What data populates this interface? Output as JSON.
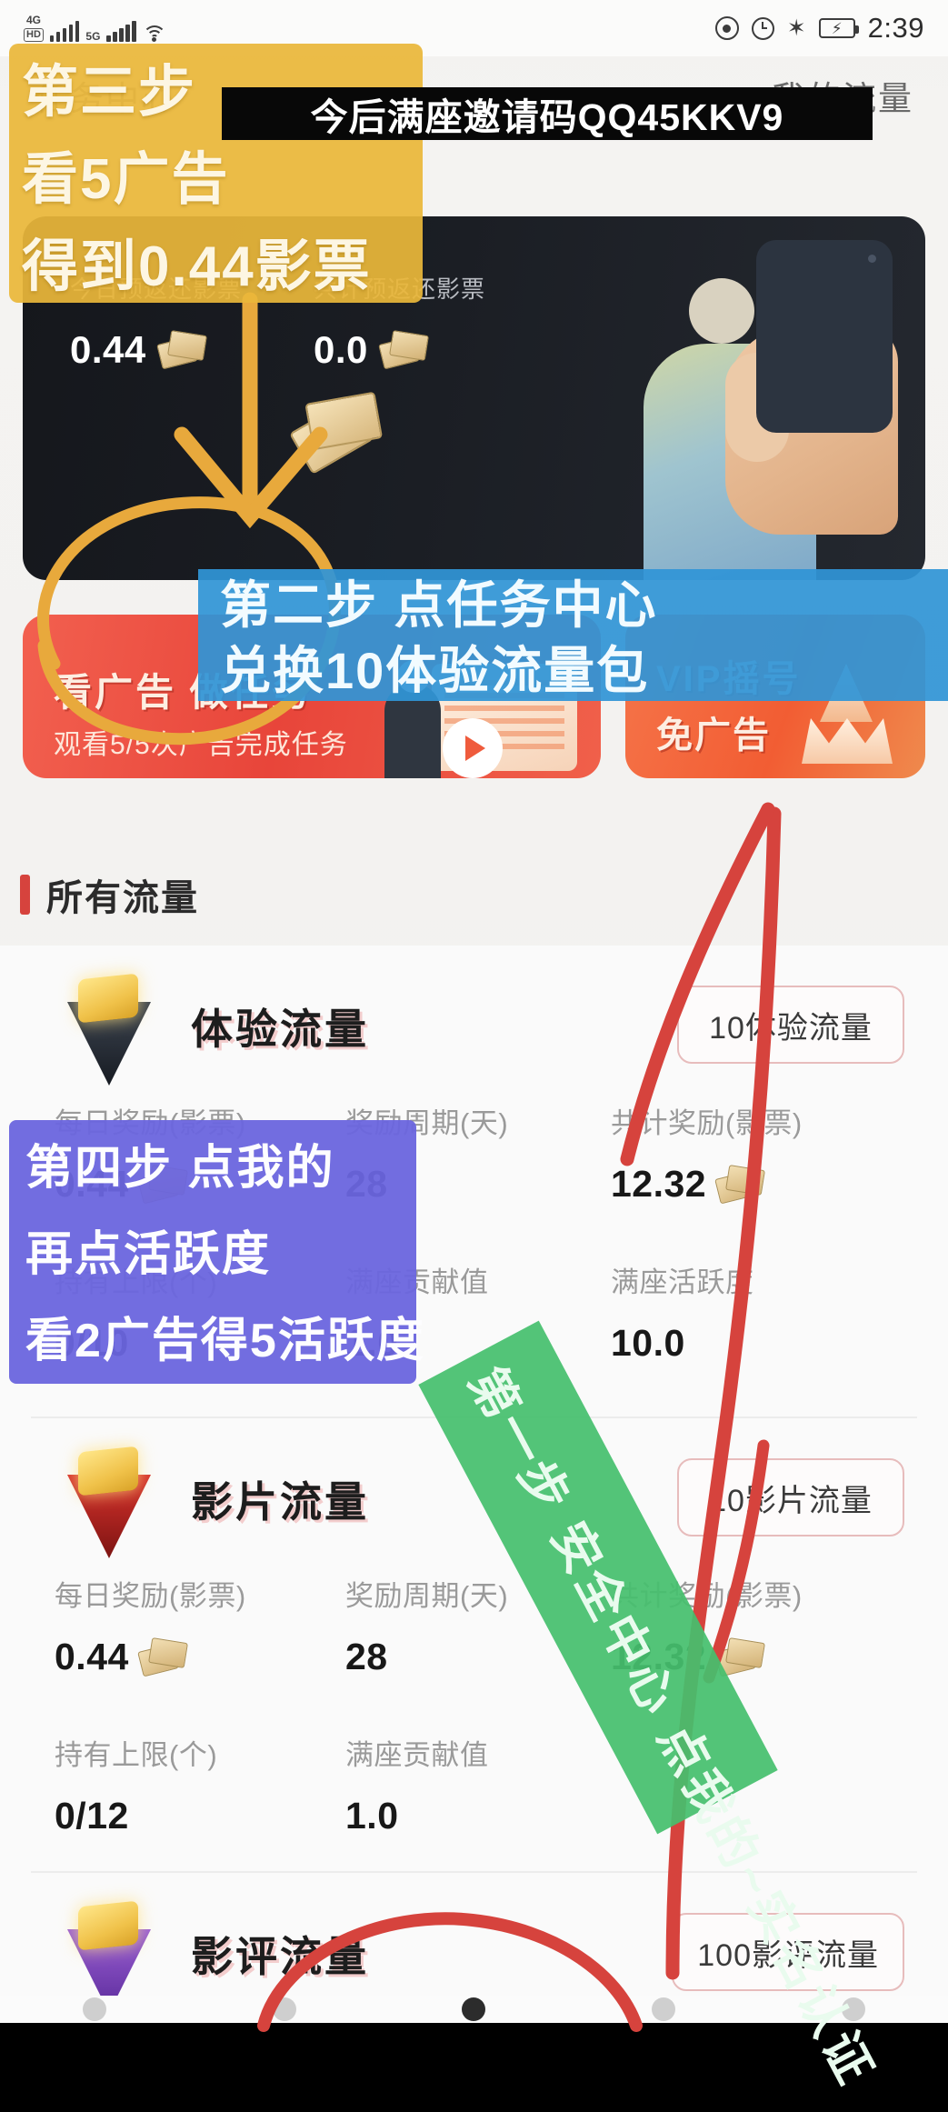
{
  "status_bar": {
    "hd_badge": "HD",
    "net_4g": "4G",
    "net_5g": "5G",
    "time": "2:39",
    "battery_icon": "battery-charging-icon",
    "bluetooth_icon": "bluetooth-icon",
    "alarm_icon": "alarm-clock-icon",
    "eye_icon": "eye-comfort-icon",
    "wifi_icon": "wifi-icon",
    "signal_icon": "signal-bars-icon"
  },
  "header": {
    "tab_task_center": "任务中心",
    "tab_my_traffic": "我的流量"
  },
  "hero": {
    "stats": [
      {
        "label": "今日预返还影票",
        "value": "0.44",
        "icon": "ticket-icon"
      },
      {
        "label": "共计预返还影票",
        "value": "0.0",
        "icon": "ticket-icon"
      }
    ],
    "illustration": "person-holding-phone-illustration"
  },
  "promos": [
    {
      "title": "看广告 做任务",
      "subtitle": "观看5/5次广告完成任务",
      "icon": "video-play-icon",
      "color": "#e8453a"
    },
    {
      "title": "VIP摇号",
      "subtitle": "免广告",
      "icon": "crown-icon",
      "color": "#f25d33"
    }
  ],
  "section": {
    "title": "所有流量",
    "accent_color": "#d6433d"
  },
  "traffic_cards": [
    {
      "name": "体验流量",
      "icon": "yellow-gem-cone-icon",
      "action_label": "10体验流量",
      "stats": [
        {
          "label": "每日奖励(影票)",
          "value": "0.44",
          "icon": "ticket-icon"
        },
        {
          "label": "奖励周期(天)",
          "value": "28",
          "icon": ""
        },
        {
          "label": "共计奖励(影票)",
          "value": "12.32",
          "icon": "ticket-icon"
        },
        {
          "label": "持有上限(个)",
          "value": "0/10",
          "icon": ""
        },
        {
          "label": "满座贡献值",
          "value": "1.0",
          "icon": ""
        },
        {
          "label": "满座活跃度",
          "value": "10.0",
          "icon": ""
        }
      ]
    },
    {
      "name": "影片流量",
      "icon": "red-gem-cone-icon",
      "action_label": "10影片流量",
      "stats": [
        {
          "label": "每日奖励(影票)",
          "value": "0.44",
          "icon": "ticket-icon"
        },
        {
          "label": "奖励周期(天)",
          "value": "28",
          "icon": ""
        },
        {
          "label": "共计奖励(影票)",
          "value": "12.32",
          "icon": "ticket-icon"
        },
        {
          "label": "持有上限(个)",
          "value": "0/12",
          "icon": ""
        },
        {
          "label": "满座贡献值",
          "value": "1.0",
          "icon": ""
        },
        {
          "label": "满座活跃度",
          "value": "10.0",
          "icon": ""
        }
      ]
    },
    {
      "name": "影评流量",
      "icon": "purple-gem-cone-icon",
      "action_label": "100影评流量",
      "stats": []
    }
  ],
  "annotations": {
    "invite_banner": "今后满座邀请码QQ45KKV9",
    "step3": {
      "line1": "第三步",
      "line2": "看5广告",
      "line3": "得到0.44影票",
      "color": "#e9b73a"
    },
    "step2": {
      "line1": "第二步  点任务中心",
      "line2": "兑换10体验流量包",
      "color": "#3094d6"
    },
    "step4": {
      "line1": "第四步 点我的",
      "line2": "再点活跃度",
      "line3": "看2广告得5活跃度",
      "color": "#6a65de"
    },
    "step1": {
      "text": "第一步  安全中心 点我的~实名认证",
      "color": "#46bf6e"
    },
    "circle_color": "#e8a93c",
    "arrow_color": "#d6433d"
  }
}
